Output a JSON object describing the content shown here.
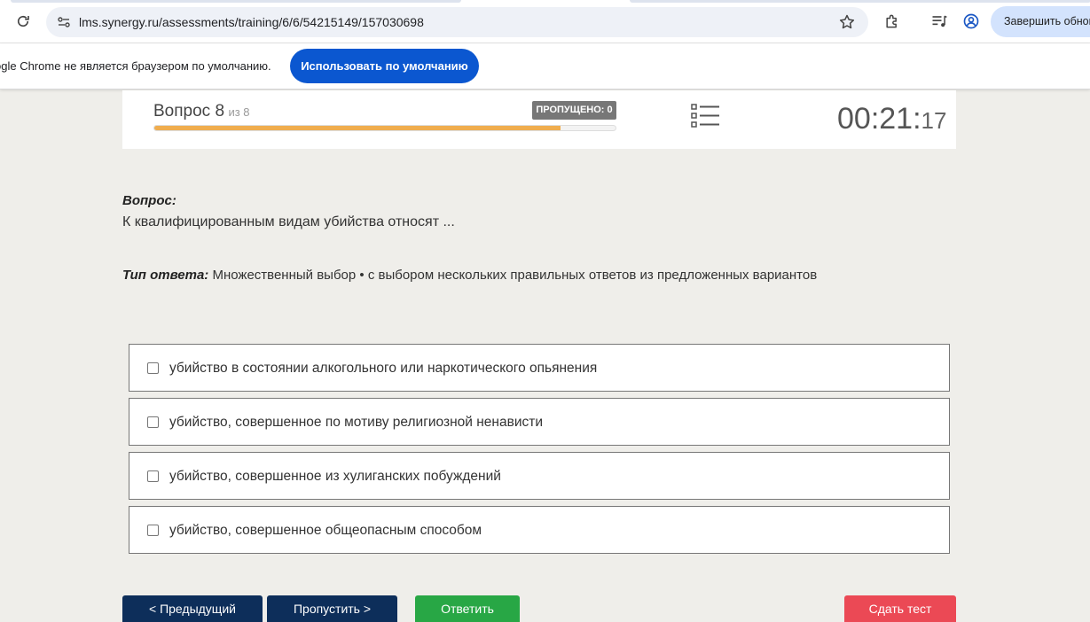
{
  "browser": {
    "url": "lms.synergy.ru/assessments/training/6/6/54215149/157030698",
    "finish_update_label": "Завершить обнов",
    "infobar_text": "ogle Chrome не является браузером по умолчанию.",
    "use_default_label": "Использовать по умолчанию"
  },
  "test": {
    "question_label": "Вопрос 8",
    "question_of": "из 8",
    "skipped_label": "ПРОПУЩЕНО: 0",
    "progress_fraction": 0.88,
    "timer_main": "00:21:",
    "timer_seconds": "17"
  },
  "question": {
    "heading": "Вопрос:",
    "text": "К квалифицированным видам убийства относят ...",
    "answer_type_label": "Тип ответа:",
    "answer_type_value": " Множественный выбор • с выбором нескольких правильных ответов из предложенных вариантов"
  },
  "options": [
    {
      "label": "убийство в состоянии алкогольного или наркотического опьянения"
    },
    {
      "label": "убийство, совершенное по мотиву религиозной ненависти"
    },
    {
      "label": "убийство, совершенное из хулиганских побуждений"
    },
    {
      "label": "убийство, совершенное общеопасным способом"
    }
  ],
  "buttons": {
    "prev": "< Предыдущий",
    "skip": "Пропустить >",
    "answer": "Ответить",
    "submit": "Сдать тест"
  },
  "colors": {
    "progress": "#f0ad4e",
    "nav_button": "#0d2e5a",
    "answer_button": "#28a745",
    "submit_button": "#eb4955",
    "default_browser_button": "#0b57d0"
  }
}
